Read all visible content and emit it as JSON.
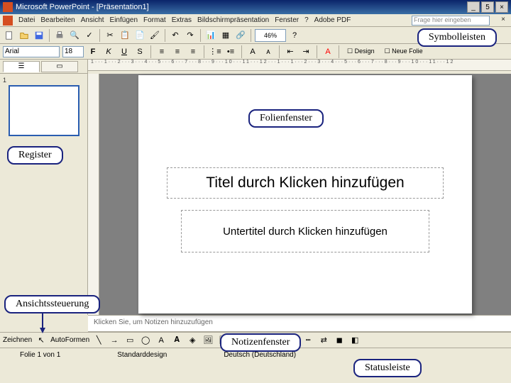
{
  "window": {
    "title": "Microsoft PowerPoint - [Präsentation1]",
    "min": "_",
    "max": "5",
    "close": "×"
  },
  "menu": {
    "items": [
      "Datei",
      "Bearbeiten",
      "Ansicht",
      "Einfügen",
      "Format",
      "Extras",
      "Bildschirmpräsentation",
      "Fenster",
      "?",
      "Adobe PDF"
    ],
    "question_placeholder": "Frage hier eingeben",
    "closex": "×"
  },
  "format": {
    "fontname": "Arial",
    "fontsize": "18",
    "bold": "F",
    "italic": "K",
    "underline": "U",
    "shadow": "S"
  },
  "tabs": {
    "outline_icon": "☰",
    "slides_icon": "▭"
  },
  "ruler": "1···1···2···3···4···5···6···7···8···9···10···11···12···1···1···2···3···4···5···6···7···8···9···10···11···12",
  "slide": {
    "title_placeholder": "Titel durch Klicken hinzufügen",
    "subtitle_placeholder": "Untertitel durch Klicken hinzufügen"
  },
  "notes": {
    "placeholder": "Klicken Sie, um Notizen hinzuzufügen"
  },
  "drawbar": {
    "draw_label": "Zeichnen",
    "autoform_label": "AutoFormen"
  },
  "status": {
    "slide_info": "Folie 1 von 1",
    "design": "Standarddesign",
    "language": "Deutsch (Deutschland)"
  },
  "annotations": {
    "symbolleisten": "Symbolleisten",
    "folienfenster": "Folienfenster",
    "register": "Register",
    "ansichtsteuerung": "Ansichtssteuerung",
    "notizenfenster": "Notizenfenster",
    "statusleiste": "Statusleiste"
  }
}
